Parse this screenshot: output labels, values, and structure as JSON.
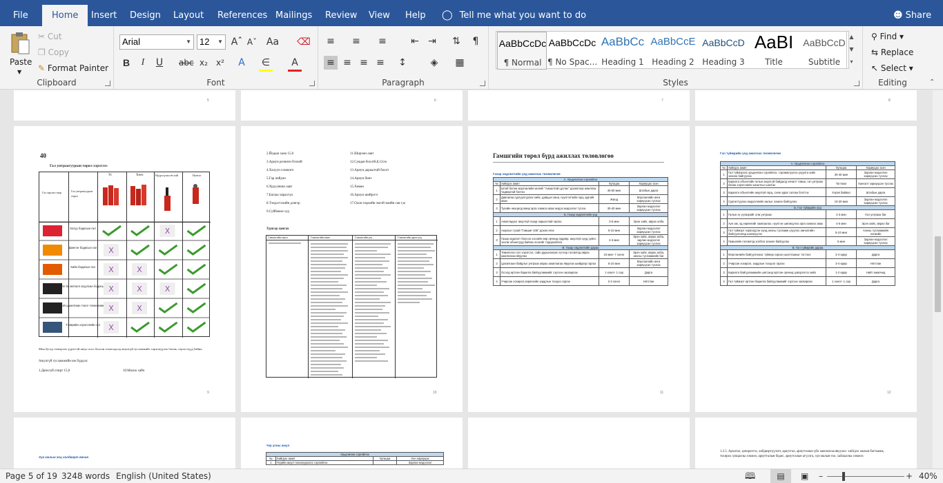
{
  "menu": {
    "items": [
      "File",
      "Home",
      "Insert",
      "Design",
      "Layout",
      "References",
      "Mailings",
      "Review",
      "View",
      "Help"
    ],
    "tell": "Tell me what you want to do",
    "share": "Share"
  },
  "clipboard": {
    "paste": "Paste",
    "cut": "Cut",
    "copy": "Copy",
    "format_painter": "Format Painter",
    "label": "Clipboard"
  },
  "font": {
    "name": "Arial",
    "size": "12",
    "label": "Font"
  },
  "paragraph": {
    "label": "Paragraph"
  },
  "styles": {
    "items": [
      {
        "preview": "AaBbCcDc",
        "name": "¶ Normal"
      },
      {
        "preview": "AaBbCcDc",
        "name": "¶ No Spac..."
      },
      {
        "preview": "AaBbCc",
        "name": "Heading 1"
      },
      {
        "preview": "AaBbCcE",
        "name": "Heading 2"
      },
      {
        "preview": "AaBbCcD",
        "name": "Heading 3"
      },
      {
        "preview": "AaBI",
        "name": "Title"
      },
      {
        "preview": "AaBbCcD",
        "name": "Subtitle"
      }
    ],
    "label": "Styles"
  },
  "editing": {
    "find": "Find",
    "replace": "Replace",
    "select": "Select",
    "label": "Editing"
  },
  "pages": {
    "top_numbers": [
      "5",
      "6",
      "7",
      "8"
    ],
    "p9": {
      "num": "9",
      "heading_num": "40",
      "title": "Гал унтраагуурын төрөл хэрэглээ",
      "cols": [
        "Ус",
        "Хөөс",
        "Нунтаг",
        "Нүүрсхүчил ён хий"
      ],
      "rows": [
        "Хатуу бодисын гал",
        "Шингэн бодисын гал",
        "Хийн бодисын гал",
        "Металл ба металл агуулсан бодисын гал",
        "Хүчдэлтэй цахилгаан тоног төхөөрөмжийн гал",
        "Тээврийн хэрэгслийн гал"
      ],
      "corner1": "Гал гарсан газар",
      "corner2": "Гал унтраагуурын төрөл",
      "para": "Мөн бусад тээвэрлэх үүрэгтэй аюул осол болсон тохиолдолд аюулгүй тусламжийг хэрэгжүүлэх багаж, хэрэгслүүд байна.",
      "list_title": "Аюулгүй тусламжийн иж бүрдэл:",
      "list1": "1.Данхгүй спирт 15,0",
      "list2": "10.Мохоо хайч"
    },
    "p10": {
      "num": "10",
      "items_left": [
        "2.Йодын хана 15,0",
        "3.Ариун резинэн бээлий",
        "4.Халуун хэмжигч",
        "5.Гар чийдэн",
        "6.Хуруувчин лавт",
        "7.Баглаа хярахгүи",
        "8.Тэндэгтэлийн дэвтэр",
        "9.Суйбовон хүү"
      ],
      "items_right": [
        "11.Ширэнн лавт",
        "12.Сувдан боолт8,8,12см",
        "13.Ариун дараалтай боолт",
        "14.Ариун бинт",
        "15.Хөвөн",
        "16.Ариун шийрэгч",
        "17.Олон төрлийн эмгэй эмийн сав т,м"
      ],
      "table_title": "Хүнсэр хангах",
      "headers": [
        "Гамшигийн төрөл",
        "Гамшигийн өмнө",
        "Гамшигийн үед",
        "Гамшигийн дараа үед"
      ]
    },
    "p11": {
      "num": "11",
      "title": "Гамшгийн төрөл бүрд ажиллах төлөвлөгөө",
      "subtitle": "Газар хөдлөлтийн үед ажиллах төлөвлөгөө",
      "sec_a": "А. Урьдчилсан сэргийлэх",
      "sec_b": "Б. Газар хөдлөлтийн үед",
      "sec_c": "В. Газар хөдлөлтийн дараа",
      "hdr": [
        "№",
        "Хийгдэх ажил",
        "Хугацаа",
        "Хариуцах эзэн"
      ],
      "rows_a": [
        [
          "1",
          "Штаб болон мэргэжлийн ангийг \"Ажаалтай цуглах\" дохиогоор ажиллах чадвартай болгох",
          "45-50 мин",
          "Штабын дарга"
        ],
        [
          "2",
          "Давлагаа суртуулгуулах хийх, давцын хана, нүүлгэлтийн гарц зургийг авах",
          "Жилд",
          "Мэргэжлийн анги хариуцсан туслах"
        ],
        [
          "3",
          "Тухайн нөхцөлд ямар арга хэмжээ авах мэдээ мэдээлэл түгээх",
          "30-40 мин",
          "Зарлан мэдээлэл хариуцсан туслах"
        ]
      ],
      "rows_b": [
        [
          "1",
          "Ажилладгыг аюулгүй газар нарыатлай гаргах",
          "3-5 мин",
          "Эрэн хайх, аврах алба"
        ],
        [
          "2",
          "Аюулын тухай \"Гамшиг-105\" дохио өгөх",
          "5-10 мин",
          "Зарлан мэдээлэл хариуцсан туслах"
        ],
        [
          "3",
          "Газар хөдлөлт болсон хэсгийн өөр орчинд ердөөр, аюулгүй хүүд зүйлс эхэлж объектууд байгаа эсэхийг тодорхойлох",
          "2-3 мин",
          "Эрэн хайх, аврах алба, зарлан мэдээлэл хариуцсан туслах"
        ]
      ],
      "rows_c": [
        [
          "1",
          "Томилогоо хүч хэрэгсэл, сайн дурынхнаас хүчээр голомтод аврах ажиллагаа явуулах",
          "10 мин- 7 хоног",
          "Эрэн хайх, аврах алба, анхны тусламжийн баг"
        ],
        [
          "2",
          "Цахилгаан байдлыг унтраах аврах ажиллагаа явуулах шийдвэр гаргах",
          "5-10 мин",
          "Мэргэжлийн анги хариуцсан туслах"
        ],
        [
          "3",
          "Осолд өртсөн барилга байгууламжийг сэргээн засварлах",
          "1 хоног- 1 сар",
          "Дарга"
        ],
        [
          "4",
          "Учирсан хохирол,хөрөнгийн зардлын тооцоо гаргах",
          "2-3 хоног",
          "Нягтлан"
        ]
      ]
    },
    "p12": {
      "num": "12",
      "title": "Гал түймрийн үед ажиллах төлөвлөгөө",
      "sec_a": "А. Урьдчилсан сэргийлэх",
      "sec_b": "Б. Гал түймрийн үед",
      "sec_c": "В. Гал түймрийн дараа",
      "hdr": [
        "№",
        "Хийгдэх ажил",
        "Хугацаа",
        "Хариуцах эзэн"
      ],
      "rows_a": [
        [
          "1",
          "Гал түймэрээс урьдчилан сэргийлэх, сэрэмжлүүлэх ухуулга хийх зохион байгуулах",
          "30-40 мин",
          "Зарлан мэдээлэл хариуцсан туслах"
        ],
        [
          "2",
          "Барилга объектийн галын аюулгүй байдалд хяналт тавьж, гал унтраах багаж хэрэгслийн ханалтыг шалгах",
          "Тогтмол",
          "Хангалт хариуцсан туслах"
        ],
        [
          "3",
          "Барилга объектийн аюулгүй гарц, схем зураг галгаж бэлтгэх",
          "Хэрэв байвал",
          "Штабын дарга"
        ],
        [
          "4",
          "Сургалтуулах мэдээллийн ажлыг зохион байгуулах",
          "10-20 мин",
          "Зарлан мэдээлэл хариуцсан туслах"
        ]
      ],
      "rows_b": [
        [
          "1",
          "Галын эх үүсвэрийг олж унтраах",
          "2-3 мин",
          "Гал унтраах баг"
        ],
        [
          "2",
          "Хүн ам, эд хөрөнгийг хамгаалах, нүүлгэн шилжүүлэх арга хэмжээ авах",
          "4-5 мин",
          "Эрэн хайх, аврах баг"
        ],
        [
          "3",
          "Гал түймэрт нэрвэгдсэн хүнд анхны тусламж үзүүлэх эмнэлгийн байгууллагад шилжүүлэх",
          "5-10 мин",
          "Анхны тусламжийн нэгжийн"
        ],
        [
          "4",
          "Гамшгийн голомтод холбоо зохион байгуулах",
          "5 мин",
          "Зарлан мэдээлэл хариуцсан туслах"
        ]
      ],
      "rows_c": [
        [
          "1",
          "Мэргэжлийн байгууллагыг түймэр гарсан шалтгааныг тогтоох",
          "3-4 өдөр",
          "Дарга"
        ],
        [
          "2",
          "Учирсан хохирол, зардлын тооцоог гаргах",
          "3-4 өдөр",
          "Нягтлан"
        ],
        [
          "3",
          "Барилга байгууламжийн шатсанд өртсөн орчинд цэвэрлэгээ хийх",
          "1-2 өдөр",
          "Нийт ажилчид"
        ],
        [
          "4",
          "Гал түймэрт өртсөн барилга байгууламжийг сэргээн засварлах",
          "1 хоног- 1 сар",
          "Дарга"
        ]
      ]
    },
    "p13": {
      "text": "Хүн малын гоц халдварт өвчин"
    },
    "p14": {
      "title": "Үер усны аюул",
      "sec": "Урьдчилан сэргийлэх",
      "hdr": [
        "№",
        "Хийгдэх ажил",
        "Хугацаа",
        "Хэн хариуцах"
      ],
      "row": [
        "1",
        "Үерийн аюул тохиолдохоос сэргийлэх",
        "",
        "Зарлан мэдээлэл"
      ]
    },
    "p16": {
      "text": "1.2.5. Архигал, цэвэрлэгээ, хийдвэртүүлэлт, ариутгал, ариутгалын үйл ажиллагаа явуулах: хийгдэх ажлын багтаамж, тохирох хувцасны хэмжээ, ариутгалын бодис, ариутгалын агуулга, хүн малын тоо, хайлаасны хэмжээ."
    }
  },
  "status": {
    "page": "Page 5 of 19",
    "words": "3248 words",
    "lang": "English (United States)",
    "zoom": "40%"
  }
}
